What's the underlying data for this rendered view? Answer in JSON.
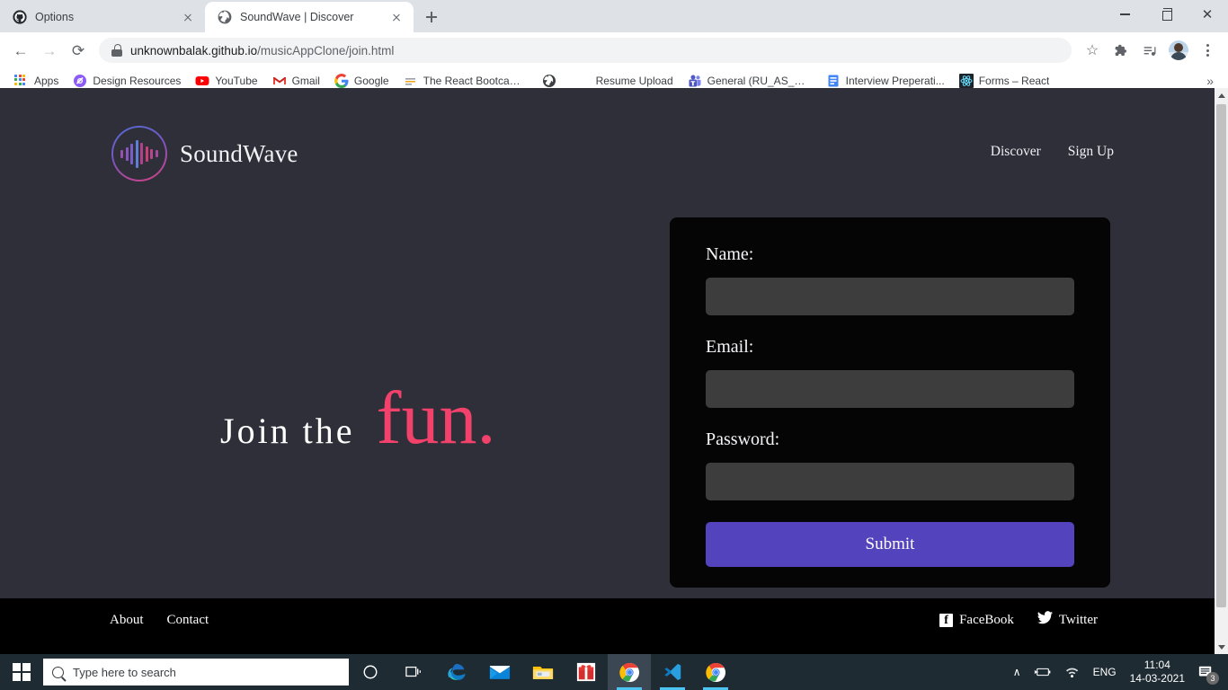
{
  "browser": {
    "tabs": [
      {
        "title": "Options",
        "favicon": "github-icon",
        "active": false
      },
      {
        "title": "SoundWave | Discover",
        "favicon": "globe-icon",
        "active": true
      }
    ],
    "newtab_label": "+",
    "window_controls": {
      "minimize": "minimize-icon",
      "maximize": "restore-icon",
      "close": "close-icon"
    },
    "toolbar": {
      "back": "←",
      "forward": "→",
      "reload": "⟳",
      "url": "unknownbalak.github.io",
      "url_path": "/musicAppClone/join.html",
      "star": "☆",
      "extensions": "puzzle-icon",
      "media": "media-icon",
      "profile": "avatar-icon",
      "menu": "kebab-icon"
    },
    "bookmarks": [
      {
        "label": "Apps",
        "icon": "apps-grid-icon"
      },
      {
        "label": "Design Resources",
        "icon": "design-resources-icon"
      },
      {
        "label": "YouTube",
        "icon": "youtube-icon"
      },
      {
        "label": "Gmail",
        "icon": "gmail-icon"
      },
      {
        "label": "Google",
        "icon": "google-icon"
      },
      {
        "label": "The React Bootcam...",
        "icon": "bootcamp-icon"
      },
      {
        "label": "",
        "icon": "globe-icon"
      },
      {
        "label": "Resume Upload",
        "icon": "none"
      },
      {
        "label": "General (RU_AS_V_...",
        "icon": "teams-icon"
      },
      {
        "label": "Interview Preperati...",
        "icon": "doc-icon"
      },
      {
        "label": "Forms – React",
        "icon": "react-icon"
      }
    ],
    "bookmarks_overflow": "»",
    "scrollbar": {
      "up": "▲",
      "down": "▼"
    }
  },
  "site": {
    "brand": "SoundWave",
    "logo_icon": "soundwave-logo-icon",
    "nav": [
      {
        "label": "Discover"
      },
      {
        "label": "Sign Up"
      }
    ],
    "hero": {
      "line_plain": "Join the",
      "line_accent": "fun."
    },
    "form": {
      "fields": [
        {
          "label": "Name:",
          "value": "",
          "placeholder": "",
          "type": "text",
          "name": "name"
        },
        {
          "label": "Email:",
          "value": "",
          "placeholder": "",
          "type": "text",
          "name": "email"
        },
        {
          "label": "Password:",
          "value": "",
          "placeholder": "",
          "type": "password",
          "name": "password"
        }
      ],
      "submit_label": "Submit"
    },
    "footer": {
      "links": [
        {
          "label": "About"
        },
        {
          "label": "Contact"
        }
      ],
      "social": [
        {
          "label": "FaceBook",
          "icon": "facebook-icon",
          "glyph": "f"
        },
        {
          "label": "Twitter",
          "icon": "twitter-icon",
          "glyph": "🐦"
        }
      ]
    },
    "colors": {
      "background": "#2f2f3a",
      "card": "#050505",
      "accent_pink": "#f2416b",
      "submit_purple": "#5343bd",
      "input": "#3d3d3d"
    }
  },
  "taskbar": {
    "start_icon": "windows-start-icon",
    "search_placeholder": "Type here to search",
    "items": [
      {
        "name": "cortana-icon"
      },
      {
        "name": "task-view-icon"
      },
      {
        "name": "edge-icon"
      },
      {
        "name": "mail-icon"
      },
      {
        "name": "file-explorer-icon"
      },
      {
        "name": "gift-icon"
      },
      {
        "name": "chrome-icon"
      },
      {
        "name": "vscode-icon"
      },
      {
        "name": "chrome-icon"
      }
    ],
    "tray": {
      "chevron": "∧",
      "battery": "battery-charging-icon",
      "wifi": "wifi-icon",
      "language": "ENG",
      "time": "11:04",
      "date": "14-03-2021",
      "notifications": "notification-icon",
      "notification_count": "3"
    }
  }
}
